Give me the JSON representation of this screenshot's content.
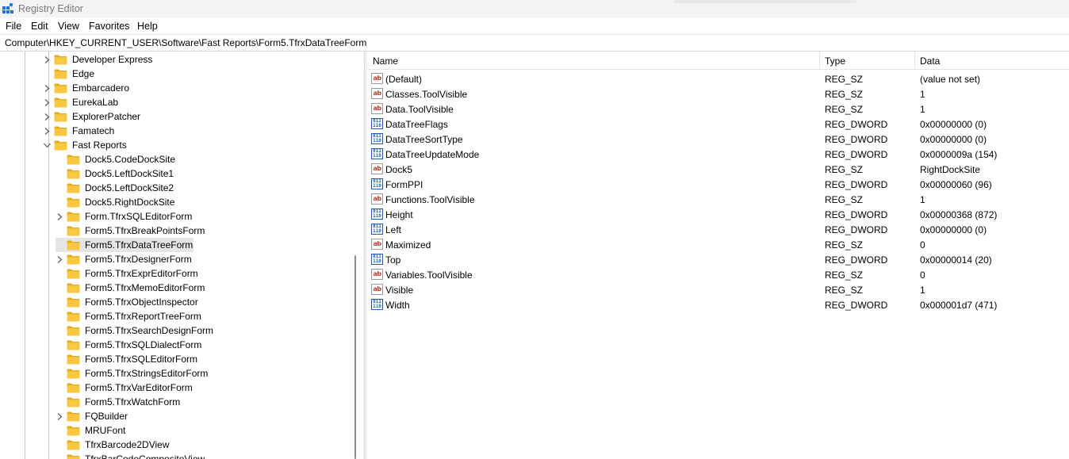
{
  "window": {
    "title": "Registry Editor",
    "icon": "registry-editor-icon"
  },
  "menu": [
    "File",
    "Edit",
    "View",
    "Favorites",
    "Help"
  ],
  "address": "Computer\\HKEY_CURRENT_USER\\Software\\Fast Reports\\Form5.TfrxDataTreeForm",
  "tree": [
    {
      "label": "Developer Express",
      "level": 1,
      "expander": "collapsed"
    },
    {
      "label": "Edge",
      "level": 1,
      "expander": "none"
    },
    {
      "label": "Embarcadero",
      "level": 1,
      "expander": "collapsed"
    },
    {
      "label": "EurekaLab",
      "level": 1,
      "expander": "collapsed"
    },
    {
      "label": "ExplorerPatcher",
      "level": 1,
      "expander": "collapsed"
    },
    {
      "label": "Famatech",
      "level": 1,
      "expander": "collapsed"
    },
    {
      "label": "Fast Reports",
      "level": 1,
      "expander": "expanded"
    },
    {
      "label": "Dock5.CodeDockSite",
      "level": 2,
      "expander": "none"
    },
    {
      "label": "Dock5.LeftDockSite1",
      "level": 2,
      "expander": "none"
    },
    {
      "label": "Dock5.LeftDockSite2",
      "level": 2,
      "expander": "none"
    },
    {
      "label": "Dock5.RightDockSite",
      "level": 2,
      "expander": "none"
    },
    {
      "label": "Form.TfrxSQLEditorForm",
      "level": 2,
      "expander": "collapsed"
    },
    {
      "label": "Form5.TfrxBreakPointsForm",
      "level": 2,
      "expander": "none"
    },
    {
      "label": "Form5.TfrxDataTreeForm",
      "level": 2,
      "expander": "none",
      "selected": true
    },
    {
      "label": "Form5.TfrxDesignerForm",
      "level": 2,
      "expander": "collapsed"
    },
    {
      "label": "Form5.TfrxExprEditorForm",
      "level": 2,
      "expander": "none"
    },
    {
      "label": "Form5.TfrxMemoEditorForm",
      "level": 2,
      "expander": "none"
    },
    {
      "label": "Form5.TfrxObjectInspector",
      "level": 2,
      "expander": "none"
    },
    {
      "label": "Form5.TfrxReportTreeForm",
      "level": 2,
      "expander": "none"
    },
    {
      "label": "Form5.TfrxSearchDesignForm",
      "level": 2,
      "expander": "none"
    },
    {
      "label": "Form5.TfrxSQLDialectForm",
      "level": 2,
      "expander": "none"
    },
    {
      "label": "Form5.TfrxSQLEditorForm",
      "level": 2,
      "expander": "none"
    },
    {
      "label": "Form5.TfrxStringsEditorForm",
      "level": 2,
      "expander": "none"
    },
    {
      "label": "Form5.TfrxVarEditorForm",
      "level": 2,
      "expander": "none"
    },
    {
      "label": "Form5.TfrxWatchForm",
      "level": 2,
      "expander": "none"
    },
    {
      "label": "FQBuilder",
      "level": 2,
      "expander": "collapsed"
    },
    {
      "label": "MRUFont",
      "level": 2,
      "expander": "none"
    },
    {
      "label": "TfrxBarcode2DView",
      "level": 2,
      "expander": "none"
    },
    {
      "label": "TfrxBarCodeCompositeView",
      "level": 2,
      "expander": "none"
    }
  ],
  "list": {
    "columns": {
      "name": "Name",
      "type": "Type",
      "data": "Data"
    },
    "rows": [
      {
        "icon": "string-value-icon",
        "name": "(Default)",
        "type": "REG_SZ",
        "data": "(value not set)"
      },
      {
        "icon": "string-value-icon",
        "name": "Classes.ToolVisible",
        "type": "REG_SZ",
        "data": "1"
      },
      {
        "icon": "string-value-icon",
        "name": "Data.ToolVisible",
        "type": "REG_SZ",
        "data": "1"
      },
      {
        "icon": "binary-value-icon",
        "name": "DataTreeFlags",
        "type": "REG_DWORD",
        "data": "0x00000000 (0)"
      },
      {
        "icon": "binary-value-icon",
        "name": "DataTreeSortType",
        "type": "REG_DWORD",
        "data": "0x00000000 (0)"
      },
      {
        "icon": "binary-value-icon",
        "name": "DataTreeUpdateMode",
        "type": "REG_DWORD",
        "data": "0x0000009a (154)"
      },
      {
        "icon": "string-value-icon",
        "name": "Dock5",
        "type": "REG_SZ",
        "data": "RightDockSite"
      },
      {
        "icon": "binary-value-icon",
        "name": "FormPPI",
        "type": "REG_DWORD",
        "data": "0x00000060 (96)"
      },
      {
        "icon": "string-value-icon",
        "name": "Functions.ToolVisible",
        "type": "REG_SZ",
        "data": "1"
      },
      {
        "icon": "binary-value-icon",
        "name": "Height",
        "type": "REG_DWORD",
        "data": "0x00000368 (872)"
      },
      {
        "icon": "binary-value-icon",
        "name": "Left",
        "type": "REG_DWORD",
        "data": "0x00000000 (0)"
      },
      {
        "icon": "string-value-icon",
        "name": "Maximized",
        "type": "REG_SZ",
        "data": "0"
      },
      {
        "icon": "binary-value-icon",
        "name": "Top",
        "type": "REG_DWORD",
        "data": "0x00000014 (20)"
      },
      {
        "icon": "string-value-icon",
        "name": "Variables.ToolVisible",
        "type": "REG_SZ",
        "data": "0"
      },
      {
        "icon": "string-value-icon",
        "name": "Visible",
        "type": "REG_SZ",
        "data": "1"
      },
      {
        "icon": "binary-value-icon",
        "name": "Width",
        "type": "REG_DWORD",
        "data": "0x000001d7 (471)"
      }
    ]
  },
  "colors": {
    "folder": "#f8c843",
    "folder_dark": "#e8a91b",
    "selection": "#e5e5e5",
    "dword_blue": "#1f5fa8",
    "sz_red": "#c0392b"
  }
}
